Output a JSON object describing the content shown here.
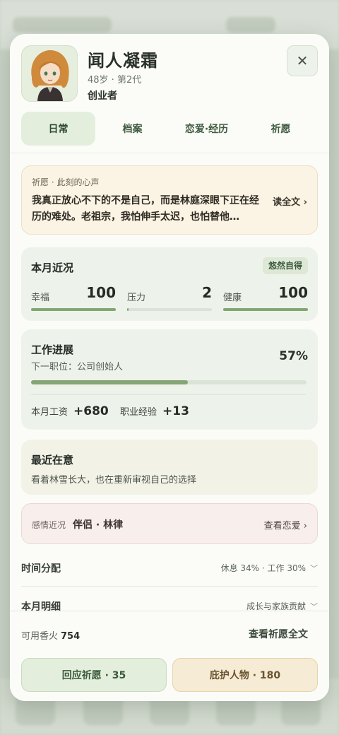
{
  "profile": {
    "name": "闻人凝霜",
    "meta": "48岁 · 第2代",
    "role": "创业者"
  },
  "tabs": [
    {
      "label": "日常",
      "active": true
    },
    {
      "label": "档案",
      "active": false
    },
    {
      "label": "恋爱·经历",
      "active": false
    },
    {
      "label": "祈愿",
      "active": false
    }
  ],
  "prayer": {
    "label": "祈愿 · 此刻的心声",
    "text": "我真正放心不下的不是自己，而是林庭深眼下正在经历的难处。老祖宗，我怕伸手太迟，也怕替他…",
    "more_label": "读全文 ›"
  },
  "month": {
    "title": "本月近况",
    "badge": "悠然自得",
    "stats": [
      {
        "label": "幸福",
        "value": "100",
        "level": 1.0
      },
      {
        "label": "压力",
        "value": "2",
        "level": 0.02
      },
      {
        "label": "健康",
        "value": "100",
        "level": 1.0
      }
    ]
  },
  "work": {
    "title": "工作进展",
    "next": "下一职位：公司创始人",
    "percent": "57%",
    "progress": 0.57,
    "salary_label": "本月工资",
    "salary_value": "+680",
    "exp_label": "职业经验",
    "exp_value": "+13"
  },
  "recent": {
    "title": "最近在意",
    "desc": "看着林雪长大，也在重新审视自己的选择"
  },
  "love": {
    "label": "感情近况",
    "partner": "伴侣 · 林律",
    "more_label": "查看恋爱 ›"
  },
  "time_row": {
    "title": "时间分配",
    "summary": "休息 34% · 工作 30%"
  },
  "detail_row": {
    "title": "本月明细",
    "summary": "成长与家族贡献"
  },
  "footer": {
    "incense_label": "可用香火",
    "incense_value": "754",
    "full_prayer_link": "查看祈愿全文",
    "respond_button": "回应祈愿 · 35",
    "protect_button": "庇护人物 · 180"
  },
  "colors": {
    "accent_green": "#86a577",
    "prayer_bg": "#fbf3e4",
    "love_bg": "#f8eeeb"
  }
}
